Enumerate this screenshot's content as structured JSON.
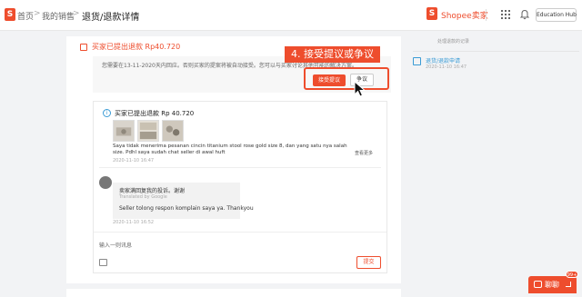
{
  "topbar": {
    "logo_glyph": "S",
    "home_label": "首页",
    "sales_label": "我的销售",
    "page_title": "退货/退款详情",
    "brand_glyph": "S",
    "brand_label": "Shopee卖家",
    "education_hub_label": "Education Hub",
    "separator_glyph": ">"
  },
  "main": {
    "header_text": "买家已提出退款 Rp40.720",
    "message_text": "您需要在13-11-2020天内回应。否则买家的提案将被自动接受。您可以与买家讨论其他可能的解决方案。",
    "accept_button_label": "接受提议",
    "dispute_button_label": "争议",
    "callout_text": "4. 接受提议或争议"
  },
  "thread": {
    "info_glyph": "i",
    "title": "买家已提出退款 Rp 40.720",
    "buyer_message": "Saya tidak menerima pesanan cincin titanium stool rose gold size 8, dan yang satu nya salah size. Pdhl saya sudah chat seller di awal huft",
    "buyer_time": "2020-11-10 16:47",
    "see_more_label": "查看更多",
    "reply_cn": "卖家满回复我的投诉。谢谢",
    "reply_translated": "Translated by Google",
    "reply_en": "Seller tolong respon komplain saya ya. Thankyou",
    "reply_time": "2020-11-10 16:52",
    "input_placeholder": "输入一则讯息",
    "send_button_label": "提交"
  },
  "sidebar": {
    "title": "处理退款的记录",
    "timeline": [
      {
        "label": "退货/退款申请",
        "time": "2020-11-10 16:47"
      }
    ]
  },
  "chat": {
    "label": "聊聊",
    "badge": "99+"
  },
  "colors": {
    "accent": "#ee4d2d",
    "link": "#3a9bd5",
    "background": "#f2f3f5"
  }
}
